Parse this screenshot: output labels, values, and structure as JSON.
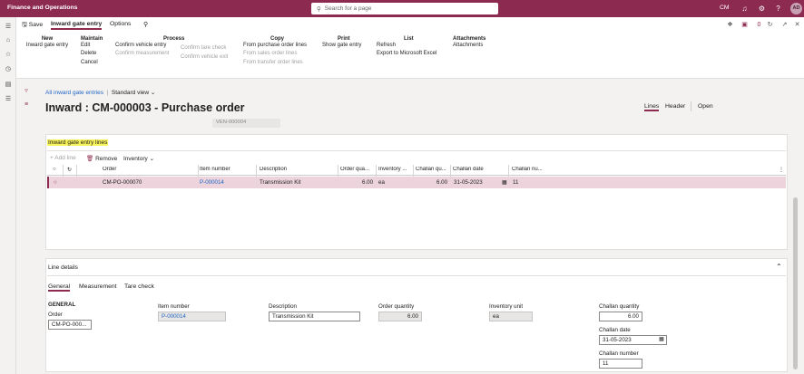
{
  "app": {
    "title": "Finance and Operations",
    "search_placeholder": "Search for a page",
    "company": "CM",
    "user_initials": "AD"
  },
  "actionpane": {
    "save_label": "Save",
    "tabs": [
      "Inward gate entry",
      "Options"
    ],
    "groups": [
      {
        "title": "New",
        "items": [
          {
            "label": "Inward gate entry",
            "disabled": false
          }
        ]
      },
      {
        "title": "Maintain",
        "items": [
          {
            "label": "Edit",
            "disabled": false
          },
          {
            "label": "Delete",
            "disabled": false
          },
          {
            "label": "Cancel",
            "disabled": false
          }
        ]
      },
      {
        "title": "Process",
        "items": [
          {
            "label": "Confirm vehicle entry",
            "disabled": false
          },
          {
            "label": "Confirm measurement",
            "disabled": true
          }
        ]
      },
      {
        "title": "",
        "items": [
          {
            "label": "Confirm tare check",
            "disabled": true
          },
          {
            "label": "Confirm vehicle exit",
            "disabled": true
          }
        ]
      },
      {
        "title": "Copy",
        "items": [
          {
            "label": "From purchase order lines",
            "disabled": false
          },
          {
            "label": "From sales order lines",
            "disabled": true
          },
          {
            "label": "From transfer order lines",
            "disabled": true
          }
        ]
      },
      {
        "title": "Print",
        "items": [
          {
            "label": "Show gate entry",
            "disabled": false
          }
        ]
      },
      {
        "title": "List",
        "items": [
          {
            "label": "Refresh",
            "disabled": false
          },
          {
            "label": "Export to Microsoft Excel",
            "disabled": false
          }
        ]
      },
      {
        "title": "Attachments",
        "items": [
          {
            "label": "Attachments",
            "disabled": false
          }
        ]
      }
    ],
    "notification_count": "0"
  },
  "page": {
    "breadcrumb_link": "All inward gate entries",
    "view_label": "Standard view",
    "title": "Inward : CM-000003 - Purchase order",
    "header_tabs": {
      "lines": "Lines",
      "header": "Header",
      "status": "Open"
    },
    "vendor_value": "VEN-000004"
  },
  "lines": {
    "section_title": "Inward gate entry lines",
    "toolbar": {
      "add": "Add line",
      "remove": "Remove",
      "inventory": "Inventory"
    },
    "columns": [
      "Order",
      "Item number",
      "Description",
      "Order qua...",
      "Inventory ...",
      "Challan qu...",
      "Challan date",
      "Challan nu..."
    ],
    "rows": [
      {
        "order": "CM-PO-000070",
        "item": "P-000014",
        "description": "Transmission Kit",
        "order_qty": "6.00",
        "inv_unit": "ea",
        "challan_qty": "6.00",
        "challan_date": "31-05-2023",
        "challan_no": "11"
      }
    ]
  },
  "details": {
    "section_title": "Line details",
    "tabs": [
      "General",
      "Measurement",
      "Tare check"
    ],
    "group_title": "GENERAL",
    "order_label": "Order",
    "order_value": "CM-PO-000...",
    "item_label": "Item number",
    "item_value": "P-000014",
    "desc_label": "Description",
    "desc_value": "Transmission Kit",
    "order_qty_label": "Order quantity",
    "order_qty_value": "6.00",
    "inv_unit_label": "Inventory unit",
    "inv_unit_value": "ea",
    "challan_qty_label": "Challan quantity",
    "challan_qty_value": "6.00",
    "challan_date_label": "Challan date",
    "challan_date_value": "31-05-2023",
    "challan_no_label": "Challan number",
    "challan_no_value": "11"
  }
}
